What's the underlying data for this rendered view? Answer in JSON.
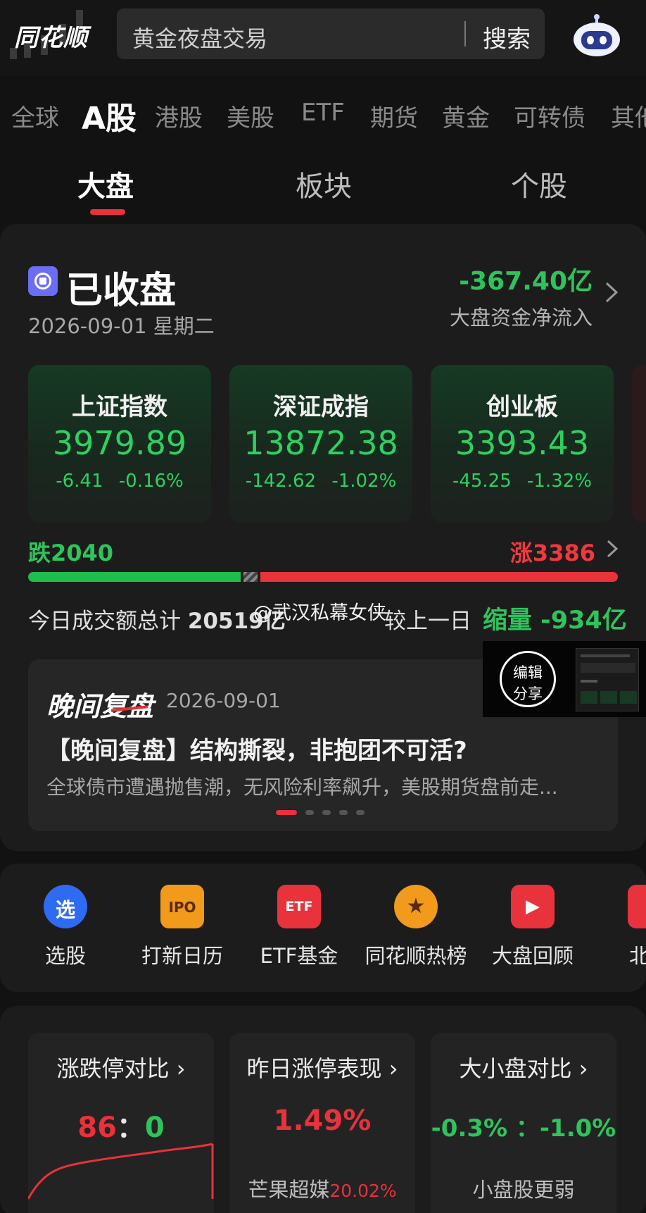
{
  "header": {
    "logo": "同花顺",
    "search_placeholder": "黄金夜盘交易",
    "search_button": "搜索",
    "icons": {
      "robot": "robot-assistant-icon"
    }
  },
  "market_tabs": [
    "全球",
    "A股",
    "港股",
    "美股",
    "ETF",
    "期货",
    "黄金",
    "可转债",
    "其他"
  ],
  "active_market_tab": "A股",
  "sub_tabs": [
    "大盘",
    "板块",
    "个股"
  ],
  "active_sub_tab": "大盘",
  "status": {
    "text": "已收盘",
    "date": "2026-09-01 星期二",
    "flow_value": "-367.40亿",
    "flow_label": "大盘资金净流入"
  },
  "indices": [
    {
      "name": "上证指数",
      "price": "3979.89",
      "change": "-6.41",
      "pct": "-0.16%"
    },
    {
      "name": "深证成指",
      "price": "13872.38",
      "change": "-142.62",
      "pct": "-1.02%"
    },
    {
      "name": "创业板",
      "price": "3393.43",
      "change": "-45.25",
      "pct": "-1.32%"
    }
  ],
  "breadth": {
    "fall_label": "跌2040",
    "rise_label": "涨3386",
    "fall": 2040,
    "rise": 3386
  },
  "volume": {
    "label": "今日成交额总计",
    "value": "20519亿",
    "compare_label": "较上一日",
    "compare_value": "缩量 -934亿",
    "watermark": "@武汉私幕女侠"
  },
  "review": {
    "tag": "晚间复盘",
    "date": "2026-09-01",
    "title": "【晚间复盘】结构撕裂，非抱团不可活?",
    "desc": "全球债市遭遇抛售潮，无风险利率飙升，美股期货盘前走..."
  },
  "float_button": {
    "line1": "编辑",
    "line2": "分享"
  },
  "shortcuts": [
    {
      "label": "选股",
      "icon": "stock-picker-icon",
      "glyph": "选",
      "color": "#2f6bf2"
    },
    {
      "label": "打新日历",
      "icon": "ipo-calendar-icon",
      "glyph": "IPO",
      "color": "#f29a1c"
    },
    {
      "label": "ETF基金",
      "icon": "etf-fund-icon",
      "glyph": "ETF",
      "color": "#e8323c"
    },
    {
      "label": "同花顺热榜",
      "icon": "hot-list-medal-icon",
      "glyph": "★",
      "color": "#f29a1c"
    },
    {
      "label": "大盘回顾",
      "icon": "market-review-video-icon",
      "glyph": "▶",
      "color": "#e8323c"
    },
    {
      "label": "北交",
      "icon": "beijiao-icon",
      "glyph": "",
      "color": "#e8323c"
    }
  ],
  "bottom_cards": [
    {
      "title": "涨跌停对比",
      "value_red": "86",
      "sep": "：",
      "value_green": "0",
      "sub": ""
    },
    {
      "title": "昨日涨停表现",
      "value": "1.49%",
      "sub_text": "芒果超媒",
      "sub_pct": "20.02%"
    },
    {
      "title": "大小盘对比",
      "value": "-0.3% ：-1.0%",
      "sub": "小盘股更弱"
    }
  ],
  "colors": {
    "up": "#e8323c",
    "down": "#2ec45b",
    "background": "#121212",
    "card": "#1c1c1c"
  }
}
